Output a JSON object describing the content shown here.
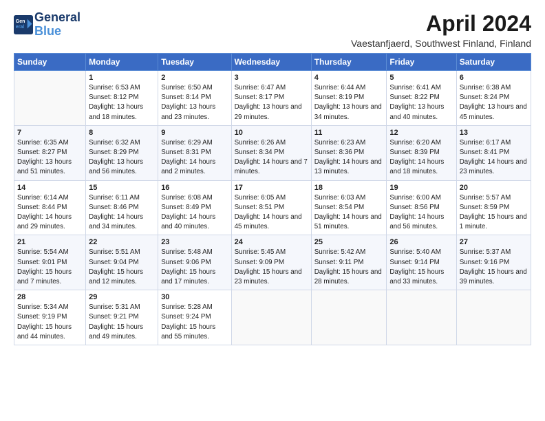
{
  "header": {
    "logo_line1": "General",
    "logo_line2": "Blue",
    "title": "April 2024",
    "subtitle": "Vaestanfjaerd, Southwest Finland, Finland"
  },
  "days_of_week": [
    "Sunday",
    "Monday",
    "Tuesday",
    "Wednesday",
    "Thursday",
    "Friday",
    "Saturday"
  ],
  "weeks": [
    [
      {
        "day": "",
        "sunrise": "",
        "sunset": "",
        "daylight": ""
      },
      {
        "day": "1",
        "sunrise": "Sunrise: 6:53 AM",
        "sunset": "Sunset: 8:12 PM",
        "daylight": "Daylight: 13 hours and 18 minutes."
      },
      {
        "day": "2",
        "sunrise": "Sunrise: 6:50 AM",
        "sunset": "Sunset: 8:14 PM",
        "daylight": "Daylight: 13 hours and 23 minutes."
      },
      {
        "day": "3",
        "sunrise": "Sunrise: 6:47 AM",
        "sunset": "Sunset: 8:17 PM",
        "daylight": "Daylight: 13 hours and 29 minutes."
      },
      {
        "day": "4",
        "sunrise": "Sunrise: 6:44 AM",
        "sunset": "Sunset: 8:19 PM",
        "daylight": "Daylight: 13 hours and 34 minutes."
      },
      {
        "day": "5",
        "sunrise": "Sunrise: 6:41 AM",
        "sunset": "Sunset: 8:22 PM",
        "daylight": "Daylight: 13 hours and 40 minutes."
      },
      {
        "day": "6",
        "sunrise": "Sunrise: 6:38 AM",
        "sunset": "Sunset: 8:24 PM",
        "daylight": "Daylight: 13 hours and 45 minutes."
      }
    ],
    [
      {
        "day": "7",
        "sunrise": "Sunrise: 6:35 AM",
        "sunset": "Sunset: 8:27 PM",
        "daylight": "Daylight: 13 hours and 51 minutes."
      },
      {
        "day": "8",
        "sunrise": "Sunrise: 6:32 AM",
        "sunset": "Sunset: 8:29 PM",
        "daylight": "Daylight: 13 hours and 56 minutes."
      },
      {
        "day": "9",
        "sunrise": "Sunrise: 6:29 AM",
        "sunset": "Sunset: 8:31 PM",
        "daylight": "Daylight: 14 hours and 2 minutes."
      },
      {
        "day": "10",
        "sunrise": "Sunrise: 6:26 AM",
        "sunset": "Sunset: 8:34 PM",
        "daylight": "Daylight: 14 hours and 7 minutes."
      },
      {
        "day": "11",
        "sunrise": "Sunrise: 6:23 AM",
        "sunset": "Sunset: 8:36 PM",
        "daylight": "Daylight: 14 hours and 13 minutes."
      },
      {
        "day": "12",
        "sunrise": "Sunrise: 6:20 AM",
        "sunset": "Sunset: 8:39 PM",
        "daylight": "Daylight: 14 hours and 18 minutes."
      },
      {
        "day": "13",
        "sunrise": "Sunrise: 6:17 AM",
        "sunset": "Sunset: 8:41 PM",
        "daylight": "Daylight: 14 hours and 23 minutes."
      }
    ],
    [
      {
        "day": "14",
        "sunrise": "Sunrise: 6:14 AM",
        "sunset": "Sunset: 8:44 PM",
        "daylight": "Daylight: 14 hours and 29 minutes."
      },
      {
        "day": "15",
        "sunrise": "Sunrise: 6:11 AM",
        "sunset": "Sunset: 8:46 PM",
        "daylight": "Daylight: 14 hours and 34 minutes."
      },
      {
        "day": "16",
        "sunrise": "Sunrise: 6:08 AM",
        "sunset": "Sunset: 8:49 PM",
        "daylight": "Daylight: 14 hours and 40 minutes."
      },
      {
        "day": "17",
        "sunrise": "Sunrise: 6:05 AM",
        "sunset": "Sunset: 8:51 PM",
        "daylight": "Daylight: 14 hours and 45 minutes."
      },
      {
        "day": "18",
        "sunrise": "Sunrise: 6:03 AM",
        "sunset": "Sunset: 8:54 PM",
        "daylight": "Daylight: 14 hours and 51 minutes."
      },
      {
        "day": "19",
        "sunrise": "Sunrise: 6:00 AM",
        "sunset": "Sunset: 8:56 PM",
        "daylight": "Daylight: 14 hours and 56 minutes."
      },
      {
        "day": "20",
        "sunrise": "Sunrise: 5:57 AM",
        "sunset": "Sunset: 8:59 PM",
        "daylight": "Daylight: 15 hours and 1 minute."
      }
    ],
    [
      {
        "day": "21",
        "sunrise": "Sunrise: 5:54 AM",
        "sunset": "Sunset: 9:01 PM",
        "daylight": "Daylight: 15 hours and 7 minutes."
      },
      {
        "day": "22",
        "sunrise": "Sunrise: 5:51 AM",
        "sunset": "Sunset: 9:04 PM",
        "daylight": "Daylight: 15 hours and 12 minutes."
      },
      {
        "day": "23",
        "sunrise": "Sunrise: 5:48 AM",
        "sunset": "Sunset: 9:06 PM",
        "daylight": "Daylight: 15 hours and 17 minutes."
      },
      {
        "day": "24",
        "sunrise": "Sunrise: 5:45 AM",
        "sunset": "Sunset: 9:09 PM",
        "daylight": "Daylight: 15 hours and 23 minutes."
      },
      {
        "day": "25",
        "sunrise": "Sunrise: 5:42 AM",
        "sunset": "Sunset: 9:11 PM",
        "daylight": "Daylight: 15 hours and 28 minutes."
      },
      {
        "day": "26",
        "sunrise": "Sunrise: 5:40 AM",
        "sunset": "Sunset: 9:14 PM",
        "daylight": "Daylight: 15 hours and 33 minutes."
      },
      {
        "day": "27",
        "sunrise": "Sunrise: 5:37 AM",
        "sunset": "Sunset: 9:16 PM",
        "daylight": "Daylight: 15 hours and 39 minutes."
      }
    ],
    [
      {
        "day": "28",
        "sunrise": "Sunrise: 5:34 AM",
        "sunset": "Sunset: 9:19 PM",
        "daylight": "Daylight: 15 hours and 44 minutes."
      },
      {
        "day": "29",
        "sunrise": "Sunrise: 5:31 AM",
        "sunset": "Sunset: 9:21 PM",
        "daylight": "Daylight: 15 hours and 49 minutes."
      },
      {
        "day": "30",
        "sunrise": "Sunrise: 5:28 AM",
        "sunset": "Sunset: 9:24 PM",
        "daylight": "Daylight: 15 hours and 55 minutes."
      },
      {
        "day": "",
        "sunrise": "",
        "sunset": "",
        "daylight": ""
      },
      {
        "day": "",
        "sunrise": "",
        "sunset": "",
        "daylight": ""
      },
      {
        "day": "",
        "sunrise": "",
        "sunset": "",
        "daylight": ""
      },
      {
        "day": "",
        "sunrise": "",
        "sunset": "",
        "daylight": ""
      }
    ]
  ]
}
